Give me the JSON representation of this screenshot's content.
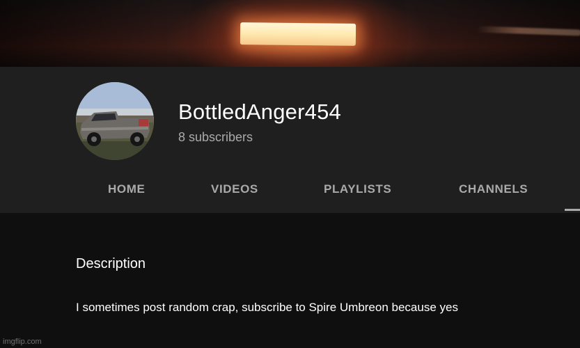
{
  "channel": {
    "name": "BottledAnger454",
    "subscribers": "8 subscribers"
  },
  "tabs": [
    {
      "label": "HOME"
    },
    {
      "label": "VIDEOS"
    },
    {
      "label": "PLAYLISTS"
    },
    {
      "label": "CHANNELS"
    }
  ],
  "about": {
    "heading": "Description",
    "description": "I sometimes post random crap, subscribe to Spire Umbreon because yes"
  },
  "watermark": "imgflip.com",
  "colors": {
    "page_background": "#0f0f0f",
    "header_background": "#1f1f1f",
    "primary_text": "#ffffff",
    "secondary_text": "#aaaaaa"
  }
}
